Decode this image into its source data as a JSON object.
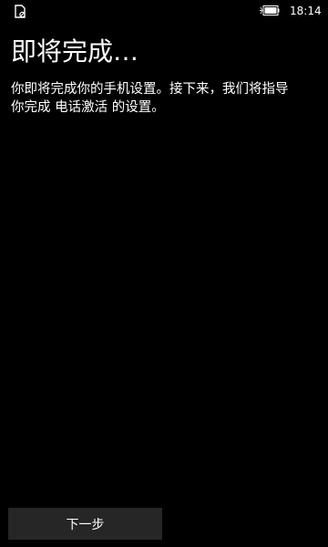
{
  "status_bar": {
    "left_icon": "sim-card-icon",
    "battery_icon": "battery-charging-icon",
    "time": "18:14"
  },
  "page": {
    "title": "即将完成…",
    "description_line1": "你即将完成你的手机设置。接下来，我们将指导",
    "description_line2_prefix": "你完成 ",
    "description_line2_highlight": "电话激活",
    "description_line2_suffix": " 的设置。"
  },
  "footer": {
    "next_label": "下一步"
  },
  "colors": {
    "background": "#000000",
    "text": "#ffffff",
    "button_background": "#262626"
  }
}
